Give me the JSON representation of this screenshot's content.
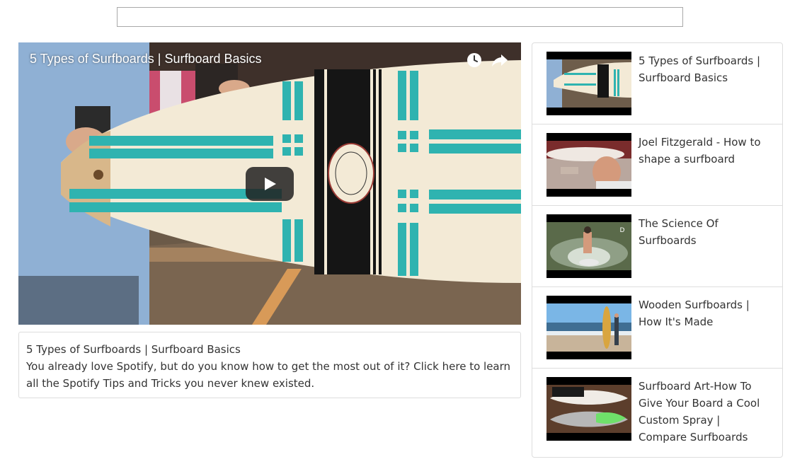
{
  "search": {
    "value": "",
    "placeholder": ""
  },
  "player": {
    "title": "5 Types of Surfboards | Surfboard Basics",
    "watch_later_icon": "clock-icon",
    "share_icon": "share-arrow-icon",
    "play_icon": "play-icon"
  },
  "description": {
    "title": "5 Types of Surfboards | Surfboard Basics",
    "text": "You already love Spotify, but do you know how to get the most out of it? Click here to learn all the Spotify Tips and Tricks you never knew existed."
  },
  "playlist": [
    {
      "title": "5 Types of Surfboards | Surfboard Basics"
    },
    {
      "title": "Joel Fitzgerald - How to shape a surfboard"
    },
    {
      "title": "The Science Of Surfboards"
    },
    {
      "title": "Wooden Surfboards | How It's Made"
    },
    {
      "title": "Surfboard Art-How To Give Your Board a Cool Custom Spray | Compare Surfboards"
    }
  ],
  "colors": {
    "accent_teal": "#2fb3b0",
    "border": "#dddddd",
    "text": "#333333",
    "play_button": "#212121"
  }
}
